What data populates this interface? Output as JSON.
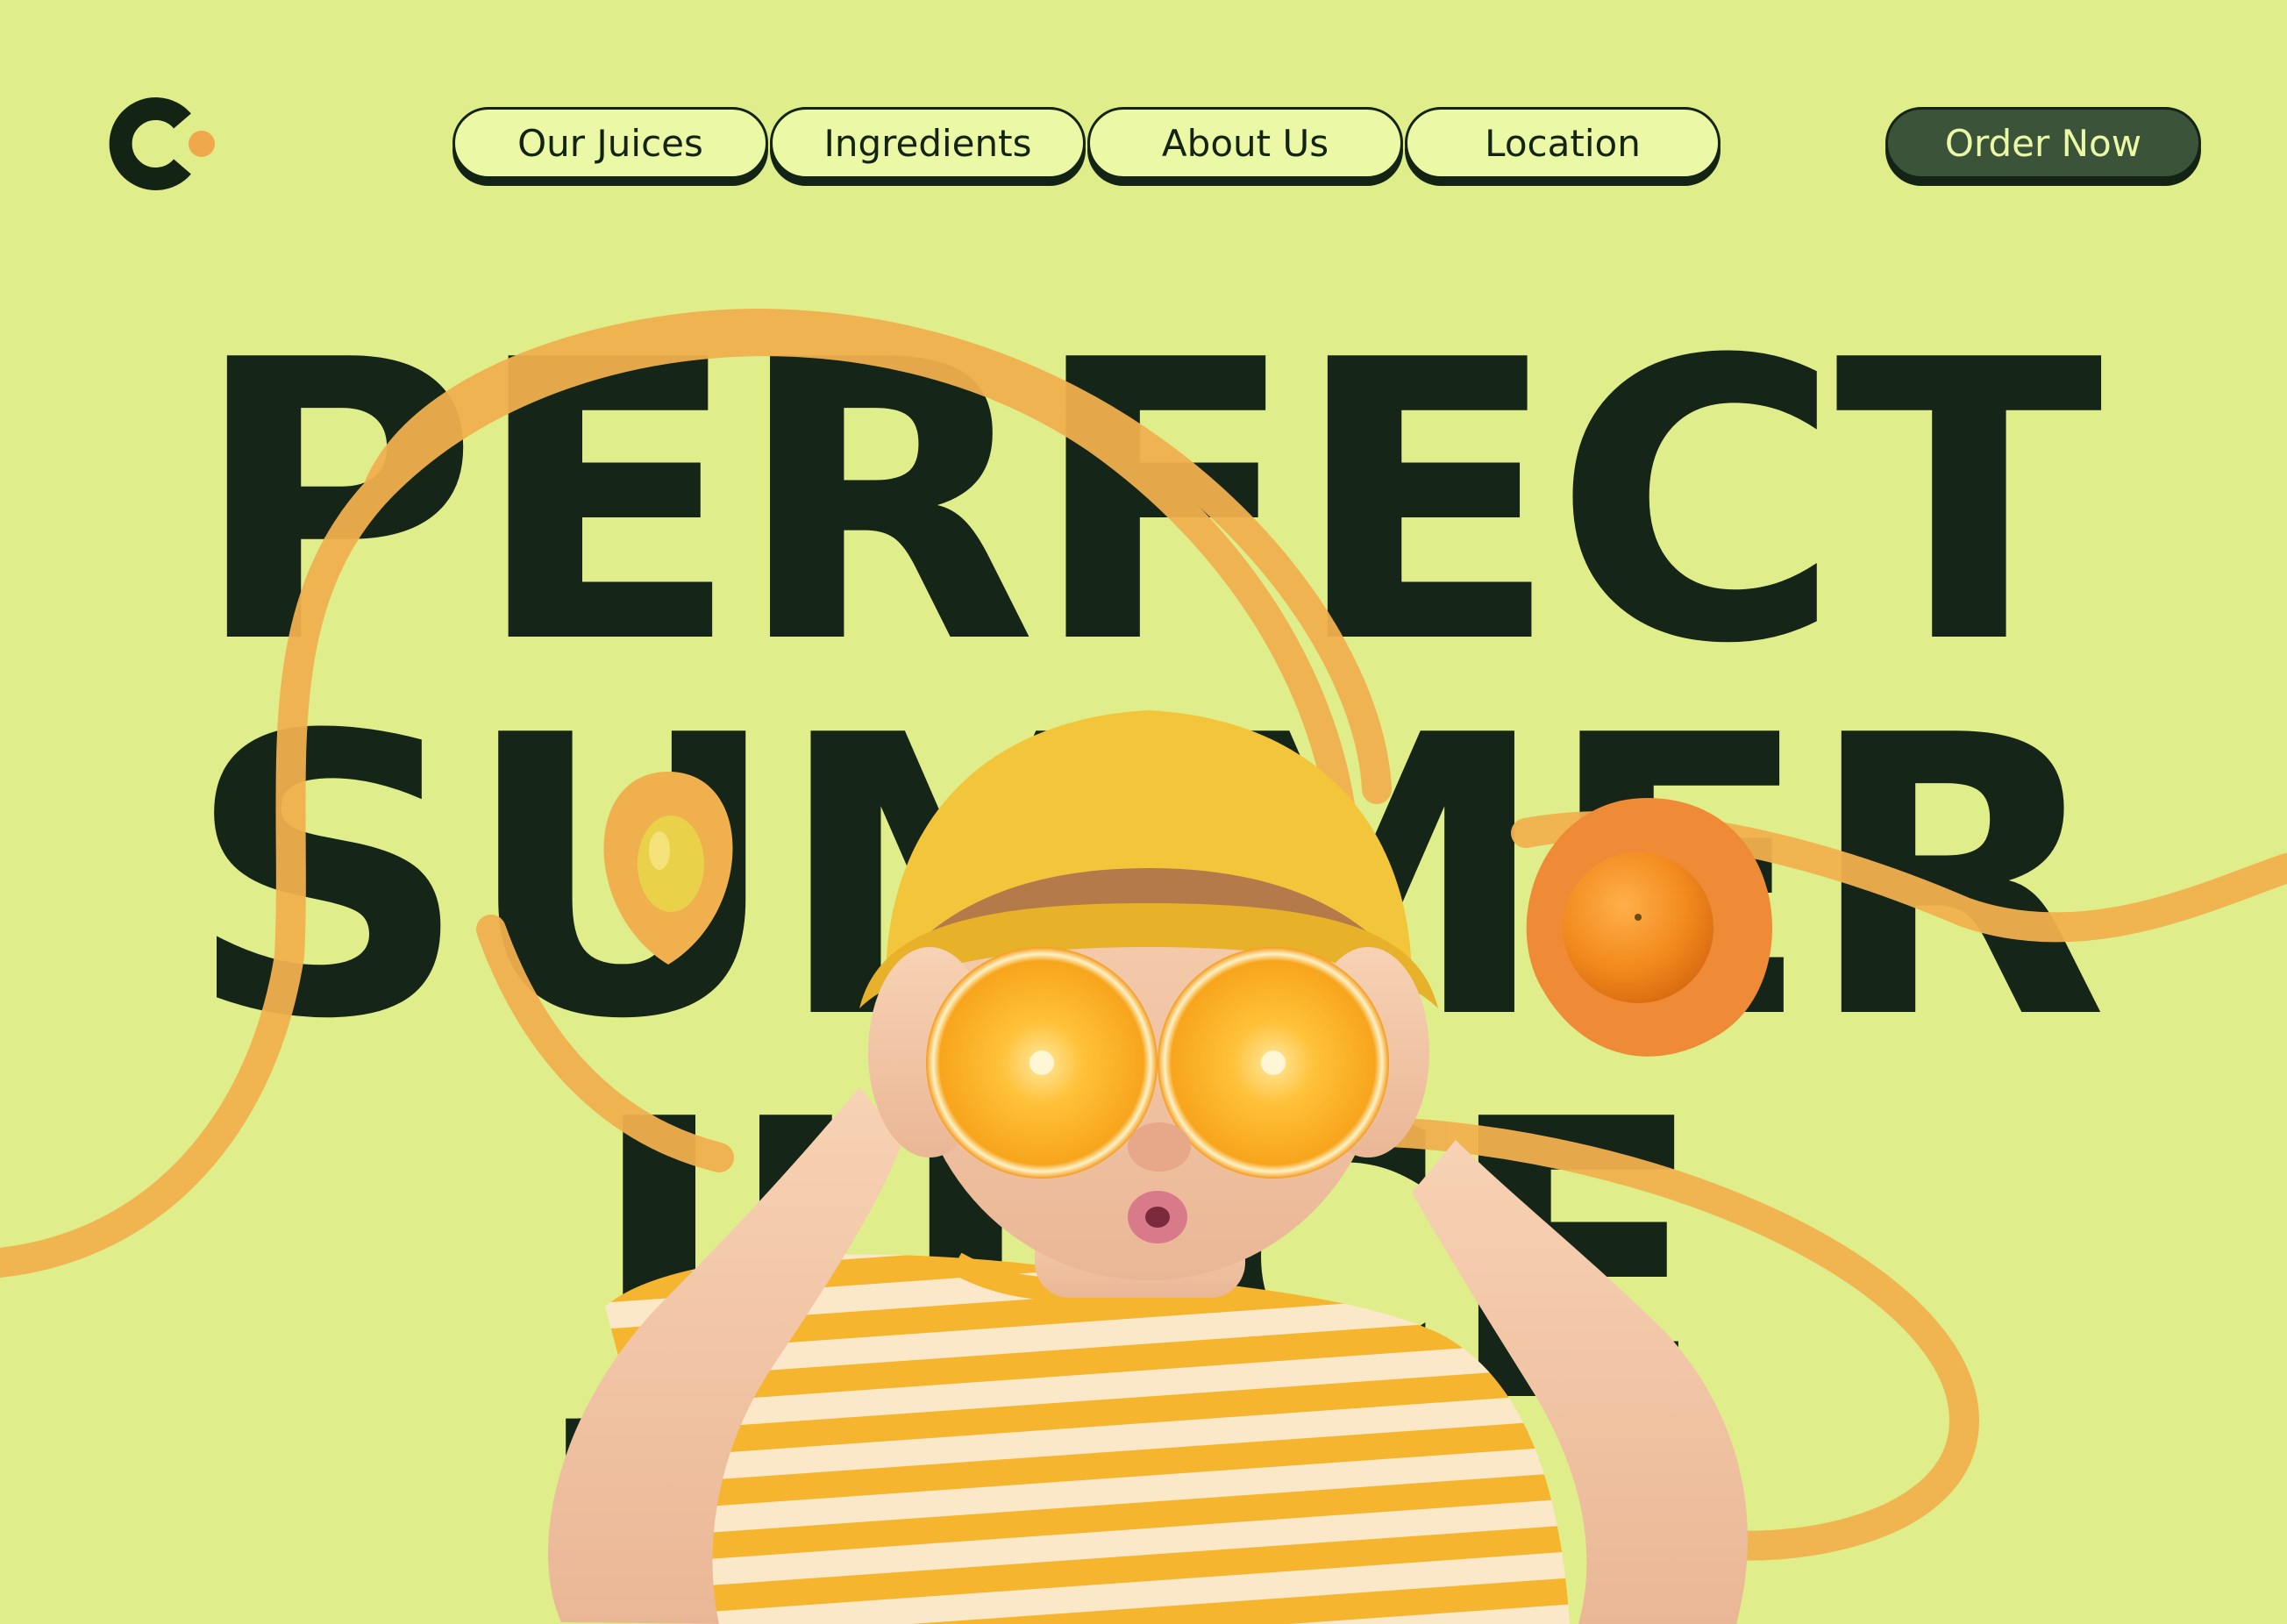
{
  "brand": {
    "logo_icon": "c-dot-logo-icon"
  },
  "nav": {
    "items": [
      {
        "label": "Our Juices"
      },
      {
        "label": "Ingredients"
      },
      {
        "label": "About Us"
      },
      {
        "label": "Location"
      }
    ]
  },
  "cta": {
    "order_label": "Order Now"
  },
  "hero": {
    "headline_lines": [
      "PERFECT",
      "SUMMER",
      "JUICE"
    ],
    "image": "child-in-yellow-hat-holding-orange-halves-over-eyes",
    "decorations": [
      "lemon-icon",
      "orange-icon",
      "orange-swirl-ribbon"
    ]
  },
  "colors": {
    "background": "#dfee8a",
    "headline": "#152518",
    "nav_pill": "#ebf8a6",
    "order_button": "#3a5339",
    "accent_orange": "#f0a94a"
  }
}
